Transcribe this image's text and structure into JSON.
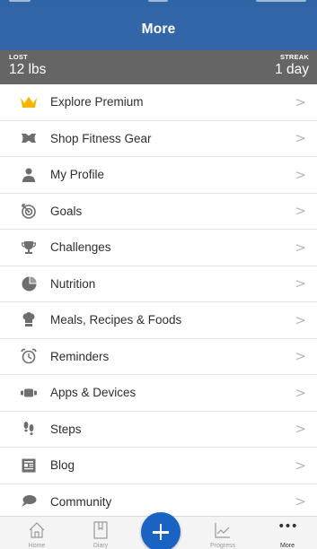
{
  "header": {
    "title": "More"
  },
  "stats": {
    "lost_caption": "LOST",
    "lost_value": "12 lbs",
    "streak_caption": "STREAK",
    "streak_value": "1 day"
  },
  "menu": {
    "chevron": ">",
    "items": [
      {
        "label": "Explore Premium",
        "icon": "crown-icon",
        "color": "#f4b400"
      },
      {
        "label": "Shop Fitness Gear",
        "icon": "under-armour-logo-icon",
        "color": "#6e6e6e"
      },
      {
        "label": "My Profile",
        "icon": "person-icon",
        "color": "#6e6e6e"
      },
      {
        "label": "Goals",
        "icon": "target-icon",
        "color": "#6e6e6e"
      },
      {
        "label": "Challenges",
        "icon": "trophy-icon",
        "color": "#6e6e6e"
      },
      {
        "label": "Nutrition",
        "icon": "pie-chart-icon",
        "color": "#6e6e6e"
      },
      {
        "label": "Meals, Recipes & Foods",
        "icon": "chef-hat-icon",
        "color": "#6e6e6e"
      },
      {
        "label": "Reminders",
        "icon": "alarm-clock-icon",
        "color": "#6e6e6e"
      },
      {
        "label": "Apps & Devices",
        "icon": "fitness-band-icon",
        "color": "#6e6e6e"
      },
      {
        "label": "Steps",
        "icon": "footprints-icon",
        "color": "#6e6e6e"
      },
      {
        "label": "Blog",
        "icon": "newspaper-icon",
        "color": "#6e6e6e"
      },
      {
        "label": "Community",
        "icon": "chat-bubbles-icon",
        "color": "#6e6e6e"
      }
    ]
  },
  "tabs": {
    "home": "Home",
    "diary": "Diary",
    "progress": "Progress",
    "more": "More",
    "more_glyph": "•••"
  },
  "colors": {
    "nav_blue": "#3266a9",
    "stats_gray": "#656565",
    "add_button_blue": "#1a63c3"
  }
}
